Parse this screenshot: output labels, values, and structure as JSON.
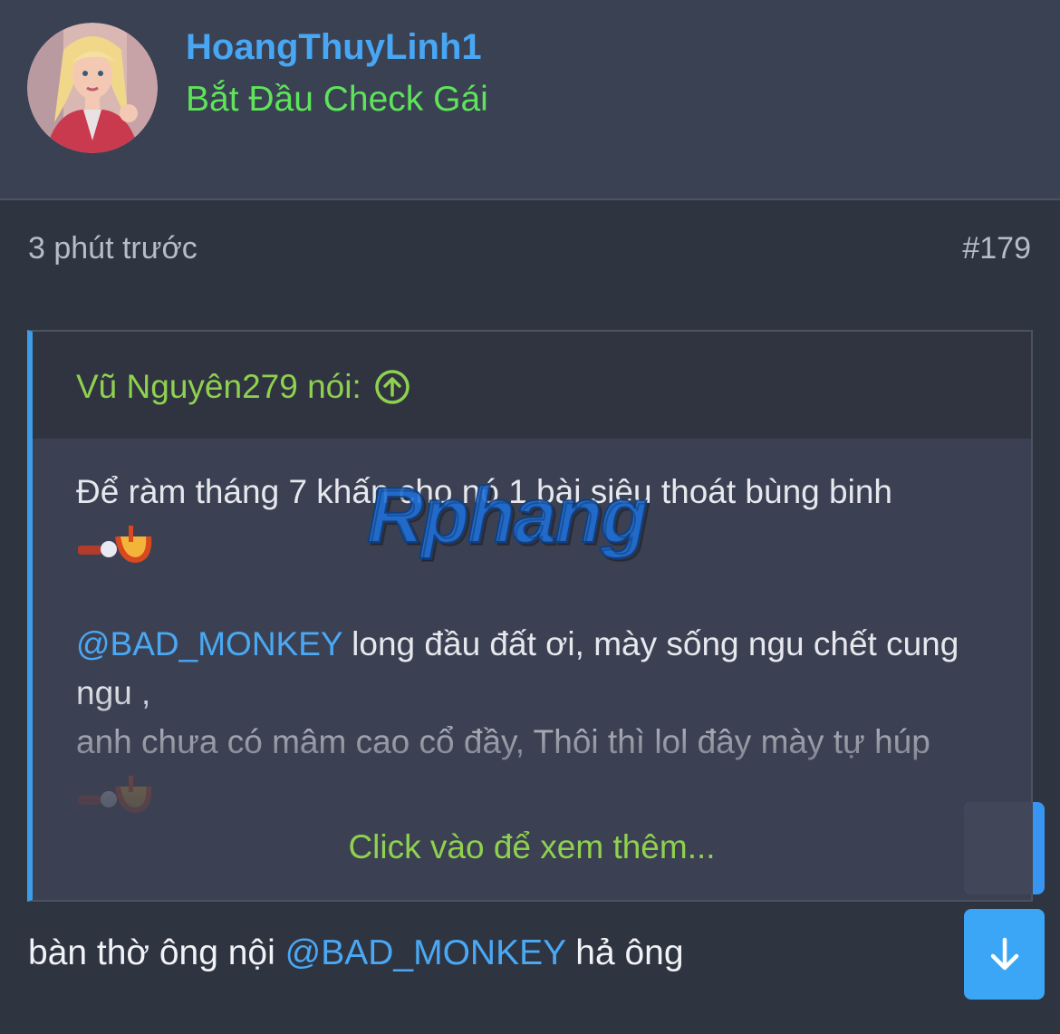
{
  "header": {
    "username": "HoangThuyLinh1",
    "user_title": "Bắt Đầu Check Gái"
  },
  "meta": {
    "time": "3 phút trước",
    "post_number": "#179"
  },
  "quote": {
    "author_label": "Vũ Nguyên279 nói:",
    "line1": "Để ràm tháng 7 khấn cho nó 1 bài siêu thoát bùng binh",
    "mention1": "@BAD_MONKEY",
    "line2_rest": " long đầu đất ơi, mày sống ngu chết cung",
    "line3": "ngu ,",
    "line4": "anh chưa có mâm cao cổ đầy, Thôi thì lol đây mày tự húp",
    "expand_label": "Click vào để xem thêm..."
  },
  "reply": {
    "before": "bàn thờ ông nội ",
    "mention": "@BAD_MONKEY",
    "after": " hả ông"
  },
  "watermark": "Rphang",
  "colors": {
    "background": "#2f3441",
    "header_bg": "#3a4152",
    "username": "#48a7f5",
    "user_title": "#5ee35a",
    "quote_accent": "#3d9de8",
    "quote_author": "#8fd14f",
    "mention": "#4aa8f4",
    "button": "#3ba6f5"
  },
  "icons": {
    "quote_jump": "arrow-up-circle-icon",
    "scroll_down": "arrow-down-icon"
  }
}
